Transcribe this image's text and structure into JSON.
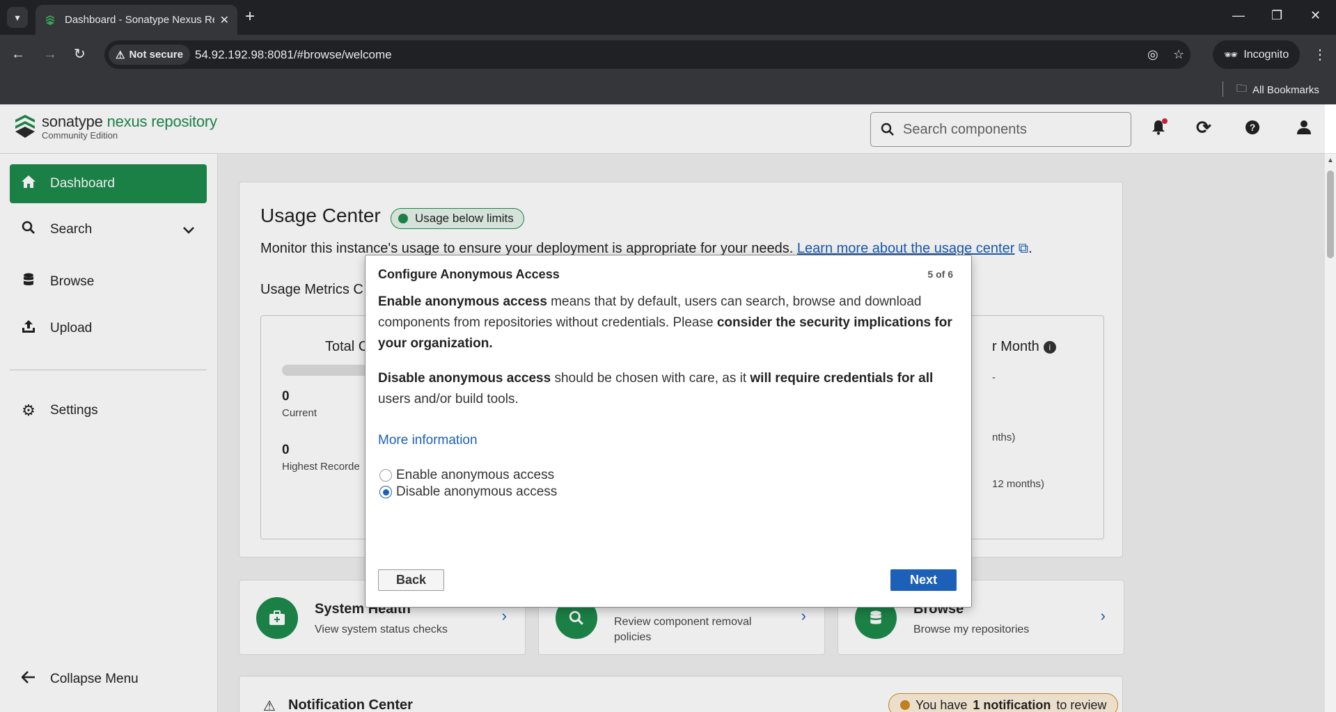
{
  "browser": {
    "tab_title": "Dashboard - Sonatype Nexus Re",
    "security_label": "Not secure",
    "url": "54.92.192.98:8081/#browse/welcome",
    "incognito_label": "Incognito",
    "bookmarks_label": "All Bookmarks"
  },
  "header": {
    "logo_main": "sonatype",
    "logo_accent": "nexus repository",
    "logo_sub": "Community Edition",
    "search_placeholder": "Search components"
  },
  "sidebar": {
    "items": [
      {
        "label": "Dashboard",
        "icon": "home-icon"
      },
      {
        "label": "Search",
        "icon": "search-icon"
      },
      {
        "label": "Browse",
        "icon": "database-icon"
      },
      {
        "label": "Upload",
        "icon": "upload-icon"
      },
      {
        "label": "Settings",
        "icon": "gear-icon"
      }
    ],
    "collapse_label": "Collapse Menu"
  },
  "usage": {
    "title": "Usage Center",
    "badge": "Usage below limits",
    "desc": "Monitor this instance's usage to ensure your deployment is appropriate for your needs.",
    "link": "Learn more about the usage center",
    "period": ".",
    "metrics_title": "Usage Metrics C",
    "total_label": "Total C",
    "month_label": "r Month",
    "current_value": "0",
    "current_label": "Current",
    "highest_value": "0",
    "highest_label": "Highest Recorde",
    "months_frag1": "nths)",
    "months_frag2": "12 months)",
    "dash_frag": "-"
  },
  "tiles": [
    {
      "title": "System Health",
      "sub": "View system status checks",
      "icon": "medkit-icon"
    },
    {
      "title": "",
      "sub": "Review component removal policies",
      "icon": "search-icon"
    },
    {
      "title": "Browse",
      "sub": "Browse my repositories",
      "icon": "database-icon"
    }
  ],
  "notifications": {
    "title": "Notification Center",
    "badge_pre": "You have",
    "badge_count": "1 notification",
    "badge_post": "to review"
  },
  "modal": {
    "title": "Configure Anonymous Access",
    "step": "5 of 6",
    "p1_b1": "Enable anonymous access",
    "p1_t1": " means that by default, users can search, browse and download components from repositories without credentials. Please ",
    "p1_b2": "consider the security implications for your organization.",
    "p2_b1": "Disable anonymous access",
    "p2_t1": " should be chosen with care, as it ",
    "p2_b2": "will require credentials for all",
    "p2_t2": " users and/or build tools.",
    "more_info": "More information",
    "option_enable": "Enable anonymous access",
    "option_disable": "Disable anonymous access",
    "selected": "Disable anonymous access",
    "back_label": "Back",
    "next_label": "Next"
  },
  "colors": {
    "brand_green": "#1e8a4c",
    "link_blue": "#1c60b8"
  }
}
